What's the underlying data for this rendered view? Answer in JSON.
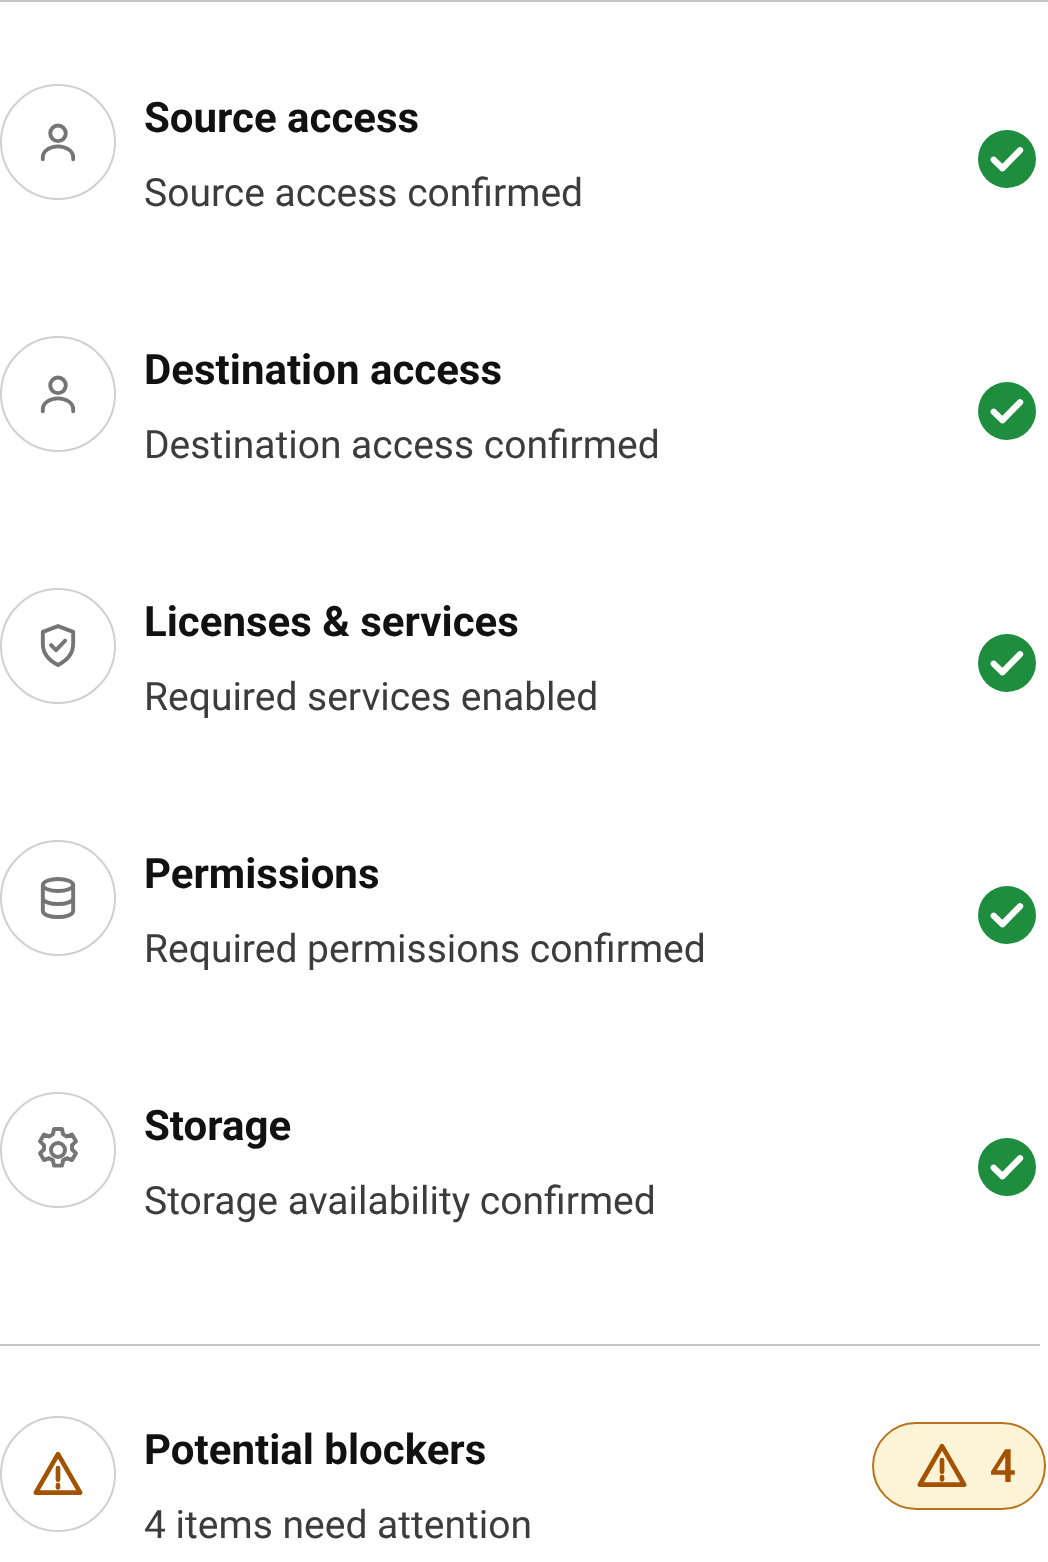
{
  "checks": [
    {
      "kind": "person",
      "title": "Source access",
      "subtitle": "Source access confirmed",
      "passed": true
    },
    {
      "kind": "person",
      "title": "Destination access",
      "subtitle": "Destination access confirmed",
      "passed": true
    },
    {
      "kind": "shield",
      "title": "Licenses & services",
      "subtitle": "Required services enabled",
      "passed": true
    },
    {
      "kind": "database",
      "title": "Permissions",
      "subtitle": "Required permissions confirmed",
      "passed": true
    },
    {
      "kind": "gear",
      "title": "Storage",
      "subtitle": "Storage availability confirmed",
      "passed": true
    }
  ],
  "blockers": {
    "title": "Potential blockers",
    "subtitle": "4 items need attention",
    "count": "4"
  }
}
